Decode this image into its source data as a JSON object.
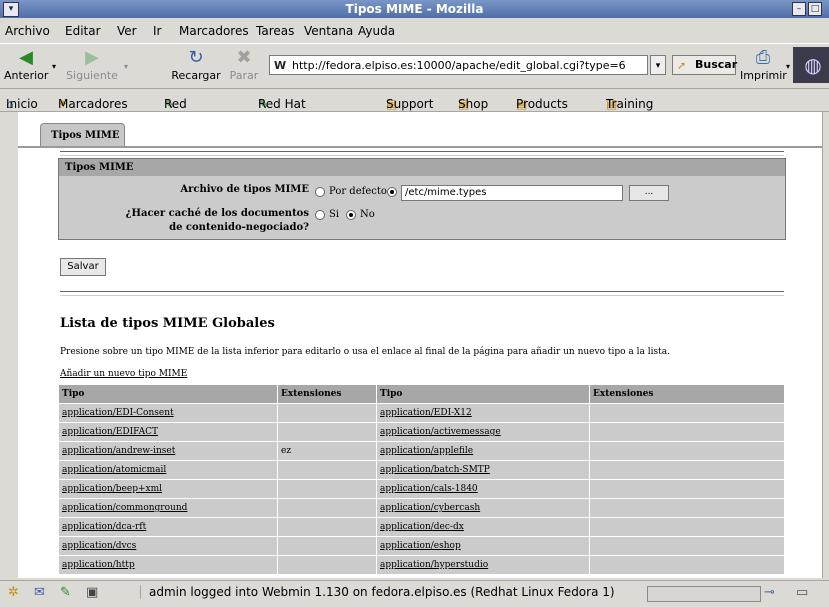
{
  "window": {
    "title": "Tipos MIME - Mozilla"
  },
  "menu": [
    "Archivo",
    "Editar",
    "Ver",
    "Ir",
    "Marcadores",
    "Tareas",
    "Ventana",
    "Ayuda"
  ],
  "nav": {
    "back": "Anterior",
    "forward": "Siguiente",
    "reload": "Recargar",
    "stop": "Parar",
    "print": "Imprimir",
    "search": "Buscar"
  },
  "url": "http://fedora.elpiso.es:10000/apache/edit_global.cgi?type=6",
  "bookmarks": [
    "Inicio",
    "Marcadores",
    "Red Hat, Inc.",
    "Red Hat Network",
    "Support",
    "Shop",
    "Products",
    "Training"
  ],
  "page": {
    "tab": "Tipos MIME",
    "form_title": "Tipos MIME",
    "mime_file_label": "Archivo de tipos MIME",
    "default_option": "Por defecto",
    "mime_file_value": "/etc/mime.types",
    "browse": "...",
    "cache_label": "¿Hacer caché de los documentos de contenido-negociado?",
    "yes": "Si",
    "no": "No",
    "save": "Salvar",
    "list_title": "Lista de tipos MIME Globales",
    "instructions": "Presione sobre un tipo MIME de la lista inferior para editarlo o usa el enlace al final de la página para añadir un nuevo tipo a la lista.",
    "add_link": "Añadir un nuevo tipo MIME",
    "columns": [
      "Tipo",
      "Extensiones",
      "Tipo",
      "Extensiones"
    ],
    "rows": [
      [
        "application/EDI-Consent",
        "",
        "application/EDI-X12",
        ""
      ],
      [
        "application/EDIFACT",
        "",
        "application/activemessage",
        ""
      ],
      [
        "application/andrew-inset",
        "ez",
        "application/applefile",
        ""
      ],
      [
        "application/atomicmail",
        "",
        "application/batch-SMTP",
        ""
      ],
      [
        "application/beep+xml",
        "",
        "application/cals-1840",
        ""
      ],
      [
        "application/commonground",
        "",
        "application/cybercash",
        ""
      ],
      [
        "application/dca-rft",
        "",
        "application/dec-dx",
        ""
      ],
      [
        "application/dvcs",
        "",
        "application/eshop",
        ""
      ],
      [
        "application/http",
        "",
        "application/hyperstudio",
        ""
      ]
    ]
  },
  "status": {
    "text": "admin logged into Webmin 1.130 on fedora.elpiso.es (Redhat Linux Fedora 1)"
  }
}
